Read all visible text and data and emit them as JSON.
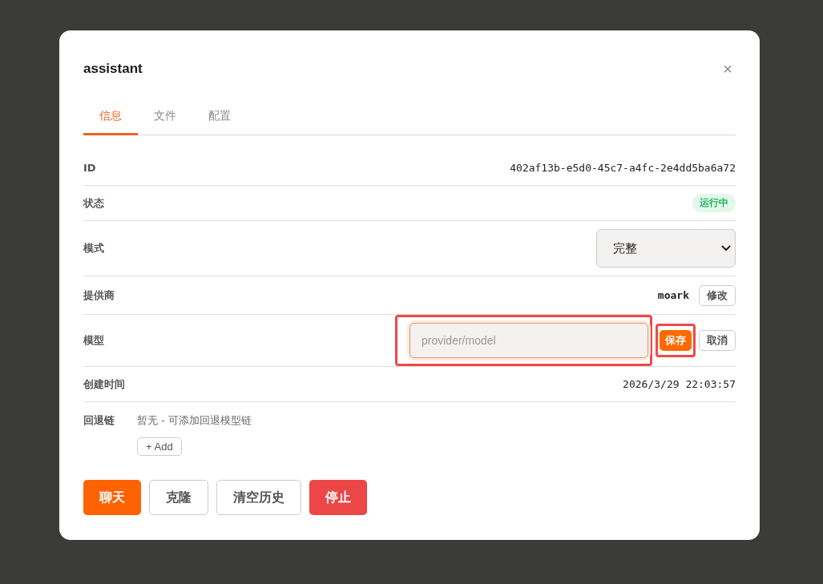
{
  "dialog": {
    "title": "assistant",
    "close": "×"
  },
  "tabs": [
    {
      "label": "信息",
      "selected": true
    },
    {
      "label": "文件",
      "selected": false
    },
    {
      "label": "配置",
      "selected": false
    }
  ],
  "rows": [
    {
      "kind": "mono",
      "label": "ID",
      "value": "402af13b-e5d0-45c7-a4fc-2e4dd5ba6a72"
    },
    {
      "kind": "badge",
      "label": "状态",
      "value": "运行中"
    },
    {
      "kind": "select",
      "label": "模式",
      "value": "完整"
    },
    {
      "kind": "edit",
      "label": "提供商",
      "value": "moark",
      "button": "修改"
    },
    {
      "kind": "input",
      "label": "模型",
      "placeholder": "provider/model",
      "save": "保存",
      "cancel": "取消",
      "highlighted": true
    },
    {
      "kind": "mono",
      "label": "创建时间",
      "value": "2026/3/29 22:03:57"
    }
  ],
  "fallback": {
    "label": "回退链",
    "text": "暂无 - 可添加回退模型链",
    "button": "+ Add"
  },
  "actions": [
    {
      "label": "聊天",
      "kind": "primary"
    },
    {
      "label": "克隆",
      "kind": "plain"
    },
    {
      "label": "清空历史",
      "kind": "plain"
    },
    {
      "label": "停止",
      "kind": "danger"
    }
  ]
}
